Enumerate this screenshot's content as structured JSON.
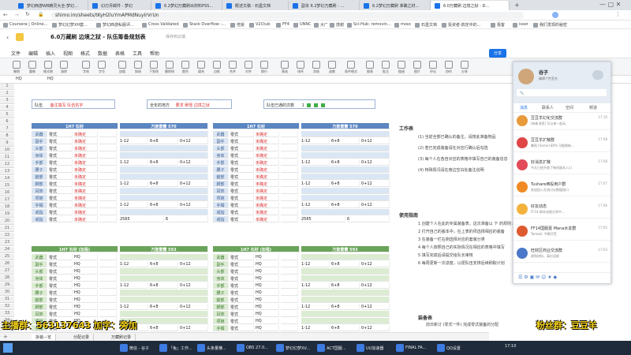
{
  "browser": {
    "tabs": [
      "梦幻西游WB精灵大全-梦幻...",
      "幻刃月邮件 - 梦幻",
      "6.2梦幻万藏刷出材料PSS...",
      "概述文稿 - 石墨文档",
      "副本 6.2梦幻万藏刷 - ...",
      "6.2梦幻万藏刷 准确之材...",
      "6.0万藏刷 边境之狱 - D..."
    ],
    "url": "shimo.im/sheets/tKyH2luYmAPMdNuyIrVrUn",
    "bookmarks": [
      "Coursera | Online...",
      "梦幻幻梦XH套...",
      "梦幻西游私服评...",
      "Cross Validated",
      "Stack Overflow -...",
      "倍受",
      "V2Ctub",
      "FF4",
      "UNNC",
      "大厂",
      "感谢",
      "Sci-Hub: removin...",
      "moxc",
      "石墨文档",
      "投资者·搞定中的...",
      "极客",
      "isser",
      "我们发现的秘密"
    ]
  },
  "doc": {
    "title": "6.0万藏刷 边境之狱 - 队伍筹备规划表",
    "saved": "保存到云端",
    "menus": [
      "文件",
      "编辑",
      "插入",
      "视图",
      "格式",
      "数据",
      "表格",
      "工具",
      "帮助"
    ],
    "ribbon_buttons": [
      "撤销",
      "重做",
      "格式刷",
      "清除",
      "字体",
      "字号",
      "加粗",
      "斜体",
      "下划线",
      "删除线",
      "颜色",
      "填充",
      "边框",
      "合并",
      "对齐",
      "换行",
      "筛选",
      "排序",
      "冻结",
      "函数",
      "条件格式",
      "图表",
      "批注",
      "链接",
      "图片",
      "评论",
      "协作",
      "分享"
    ],
    "formula_ref": "HQ",
    "formula_val": "HQ",
    "share": "分享"
  },
  "sheet": {
    "rows": [
      "1",
      "2",
      "3",
      "4",
      "5",
      "6",
      "7",
      "8",
      "9",
      "10",
      "11",
      "12",
      "13",
      "14",
      "15",
      "16",
      "17",
      "18",
      "19",
      "20",
      "21",
      "22",
      "23",
      "24",
      "25",
      "26",
      "27",
      "28",
      "29",
      "30",
      "31",
      "32",
      "33",
      "34",
      "35",
      "36"
    ],
    "top_boxes": [
      {
        "label": "队伍",
        "value": "备注填写 队伍名字"
      },
      {
        "label": "全年的地方",
        "value": "要求 刷怪 边境之狱"
      },
      {
        "label": "队伍已通的次数",
        "value": "1"
      }
    ],
    "jobs": [
      "武器",
      "副手",
      "头部",
      "身体",
      "手部",
      "腰子",
      "腿部",
      "脚部",
      "耳饰",
      "项链",
      "手镯",
      "戒指",
      "戒指"
    ],
    "blue_header1": "1H7 石材",
    "blue_header2": "万能雷霆 570",
    "green_header1": "1H7 石材 (加强)",
    "green_header2": "万能雷霆 593",
    "vals": {
      "a": "零式",
      "b": "永恒之",
      "c": "未确定",
      "d": "石材",
      "e": "HQ",
      "f": "2565",
      "g": "6",
      "h": "1-12",
      "i": "6+8",
      "j": "0+12"
    },
    "notes_title": "工作表",
    "notes": [
      "(1) 当前全部已确认的备注，请按此准备物品",
      "(2) 若已完成装备请在对应行确认后勾选",
      "(3) 每个人在各自对应的表格中填写自己的装备信息",
      "(4) 特殊情况请在旁边空白处备注说明"
    ],
    "usage_title": "使用指南",
    "usage": [
      "1 创建个人在此的专属装备表，这次准备以 下 的规则：",
      "2 打开自己的版本中，在上表的项选择相应的装备",
      "3 在装备一栏右侧选择对应的套装分类",
      "4 每个人按照自己的实际情况在相应的表格中填写",
      "5 填写完成后请提交给队长审核",
      "6 每周更新一次进度，以便队伍安排后续刷取计划"
    ],
    "more_title": "装备表",
    "more_row": "前日新订 (零式一件) 完成零式装备的分配"
  },
  "sheet_tabs": [
    "拆装—览",
    "分配记录",
    "万藏刷记录"
  ],
  "qq": {
    "name": "谷子",
    "status": "编辑个性签名",
    "tabs": [
      "消息",
      "联系人",
      "空间",
      "频道"
    ],
    "chats": [
      {
        "name": "豆豆羊幻化交流群",
        "msg": "[有新消息] 可以来一起玩",
        "time": "17:10",
        "color": "#e89a3c"
      },
      {
        "name": "豆豆羊扩散群",
        "msg": "暴雨 [Some] 80% 可能刷新...",
        "time": "17:08",
        "color": "#e04646"
      },
      {
        "name": "好消息扩散",
        "msg": "今天已经开放了新的副本入口",
        "time": "17:08",
        "color": "#e24b5a"
      },
      {
        "name": "Tushare西投用户群",
        "msg": "欢迎加入交流讨论数据接口",
        "time": "17:07",
        "color": "#f08a24"
      },
      {
        "name": "好友动态",
        "msg": "FF14 刷本进度分享中...",
        "time": "17:06",
        "color": "#f3b23b"
      },
      {
        "name": "FF14国服嘉 Mana水友群",
        "msg": "Tamaki: 今晚开荒",
        "time": "17:05",
        "color": "#de5a2f"
      },
      {
        "name": "旺财区商业交流群",
        "msg": "收购材料，高价回收",
        "time": "17:03",
        "color": "#4a78c9"
      }
    ]
  },
  "overlays": {
    "left": "主播群：563137643 加字：旁加",
    "right": "粉丝群：豆豆羊"
  },
  "taskbar": [
    "微信 - 谷子",
    "「兔」工作...",
    "头条量横...",
    "OBS 27.0...",
    "梦幻幻梦XV...",
    "ACT国服...",
    "UU加速器",
    "FINAL FA...",
    "QQ设置"
  ],
  "clock": "17:10"
}
